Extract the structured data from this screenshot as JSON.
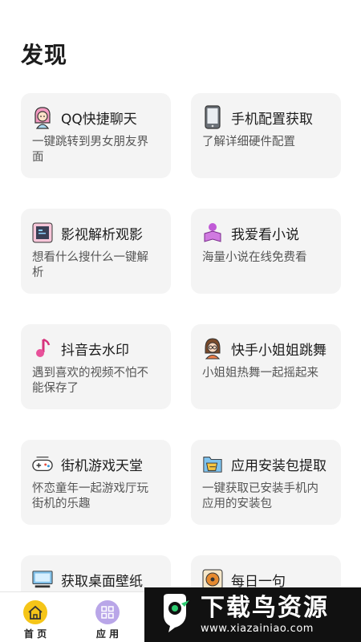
{
  "page": {
    "title": "发现"
  },
  "cards": [
    {
      "title": "QQ快捷聊天",
      "desc": "一键跳转到男女朋友界面",
      "icon": "girl-avatar-icon"
    },
    {
      "title": "手机配置获取",
      "desc": "了解详细硬件配置",
      "icon": "phone-icon"
    },
    {
      "title": "影视解析观影",
      "desc": "想看什么搜什么一键解析",
      "icon": "tv-icon"
    },
    {
      "title": "我爱看小说",
      "desc": "海量小说在线免费看",
      "icon": "reader-icon"
    },
    {
      "title": "抖音去水印",
      "desc": "遇到喜欢的视频不怕不能保存了",
      "icon": "music-note-icon"
    },
    {
      "title": "快手小姐姐跳舞",
      "desc": "小姐姐热舞一起摇起来",
      "icon": "girl-glasses-icon"
    },
    {
      "title": "街机游戏天堂",
      "desc": "怀恋童年一起游戏厅玩街机的乐趣",
      "icon": "gamepad-icon"
    },
    {
      "title": "应用安装包提取",
      "desc": "一键获取已安装手机内应用的安装包",
      "icon": "package-icon"
    },
    {
      "title": "获取桌面壁纸",
      "desc": "",
      "icon": "desktop-icon"
    },
    {
      "title": "每日一句",
      "desc": "",
      "icon": "record-icon"
    }
  ],
  "tabbar": {
    "home": {
      "label": "首 页",
      "icon": "home-icon"
    },
    "apps": {
      "label": "应 用",
      "icon": "apps-icon"
    }
  },
  "watermark": {
    "title": "下载鸟资源",
    "url": "www.xiazainiao.com",
    "logo": "bird-logo-icon"
  },
  "colors": {
    "card_bg": "#f4f4f4",
    "home_tab": "#f5c518",
    "apps_tab": "#b9a6e8"
  }
}
